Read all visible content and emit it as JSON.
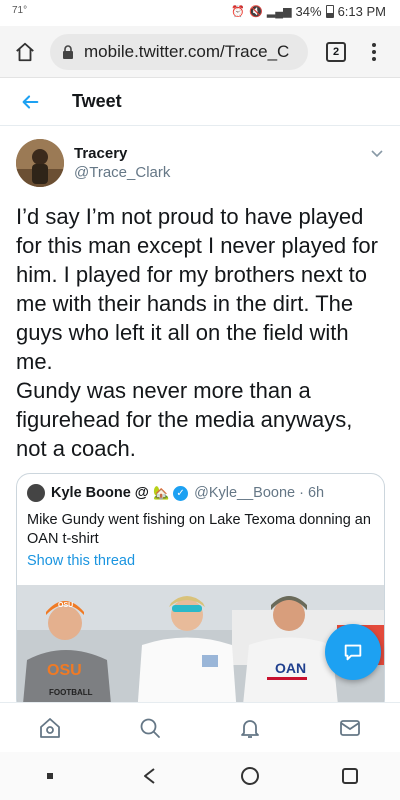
{
  "status_bar": {
    "temperature": "71°",
    "battery_percent": "34%",
    "time": "6:13 PM"
  },
  "browser": {
    "url": "mobile.twitter.com/Trace_C",
    "tab_count": "2"
  },
  "header": {
    "title": "Tweet"
  },
  "tweet": {
    "author_name": "Tracery",
    "author_handle": "@Trace_Clark",
    "text": "I’d say I’m not proud to have played for this man except I never played for him. I played for my brothers next to me with their hands in the dirt. The guys who left it all on the field with me.\nGundy was never more than a figurehead for the media anyways, not a coach."
  },
  "quoted_tweet": {
    "author_name": "Kyle Boone @",
    "author_emoji": "🏡",
    "author_handle": "@Kyle__Boone",
    "separator": "·",
    "time_ago": "6h",
    "text": "Mike Gundy went fishing on Lake Texoma donning an OAN t-shirt",
    "show_thread_label": "Show this thread",
    "image_texts": {
      "cap_logo": "OSU",
      "shirt_left_logo": "OSU",
      "shirt_left_text": "FOOTBALL",
      "shirt_right_logo": "OAN"
    }
  },
  "colors": {
    "accent": "#1da1f2",
    "link": "#1b95e0",
    "secondary_text": "#657786",
    "border": "#ccd6dd"
  },
  "icons": {
    "bottom_tabs": [
      "home-icon",
      "search-icon",
      "notifications-icon",
      "messages-icon"
    ],
    "android_nav": [
      "recent-apps-icon",
      "back-icon",
      "home-circle-icon",
      "overview-icon"
    ]
  }
}
